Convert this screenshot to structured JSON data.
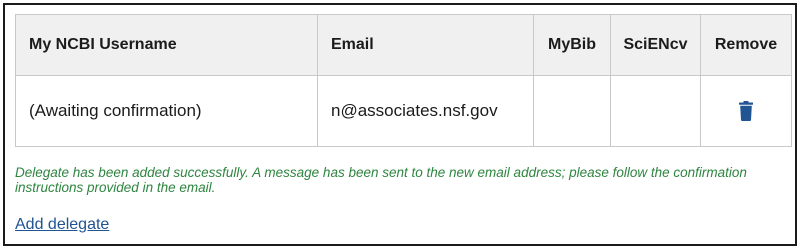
{
  "table": {
    "headers": {
      "username": "My NCBI Username",
      "email": "Email",
      "mybib": "MyBib",
      "sciencv": "SciENcv",
      "remove": "Remove"
    },
    "rows": [
      {
        "username": "(Awaiting confirmation)",
        "email": "n@associates.nsf.gov",
        "mybib": "",
        "sciencv": "",
        "remove_icon": "trash-icon"
      }
    ]
  },
  "message": "Delegate has been added successfully. A message has been sent to the new email address; please follow the confirmation instructions provided in the email.",
  "add_delegate_label": "Add delegate",
  "colors": {
    "success_text": "#2e8540",
    "link": "#205493",
    "trash_icon": "#205493",
    "header_bg": "#f0f0f0",
    "border": "#c9c9c9"
  }
}
